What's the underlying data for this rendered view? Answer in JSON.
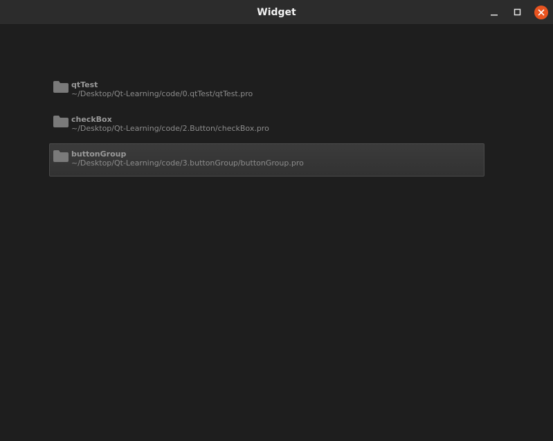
{
  "window": {
    "title": "Widget",
    "controls": {
      "minimize": "minimize-icon",
      "maximize": "maximize-icon",
      "close": "close-icon"
    }
  },
  "colors": {
    "background": "#1e1e1e",
    "titlebar": "#2c2c2c",
    "close_accent": "#e95420",
    "folder_icon": "#7a7a7a"
  },
  "projects": [
    {
      "name": "qtTest",
      "path": "~/Desktop/Qt-Learning/code/0.qtTest/qtTest.pro",
      "selected": false,
      "icon": "folder-icon"
    },
    {
      "name": "checkBox",
      "path": "~/Desktop/Qt-Learning/code/2.Button/checkBox.pro",
      "selected": false,
      "icon": "folder-icon"
    },
    {
      "name": "buttonGroup",
      "path": "~/Desktop/Qt-Learning/code/3.buttonGroup/buttonGroup.pro",
      "selected": true,
      "icon": "folder-icon"
    }
  ]
}
